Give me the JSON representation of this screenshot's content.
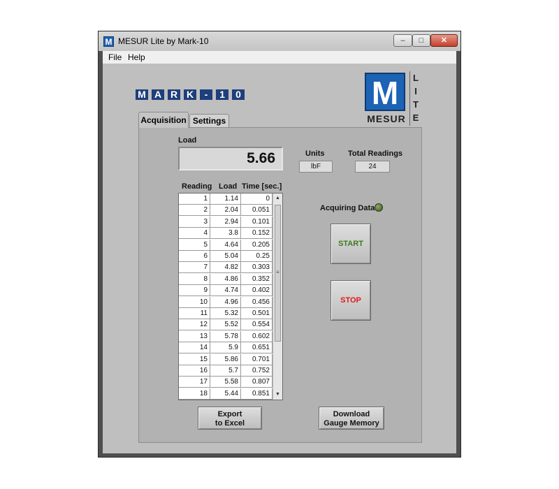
{
  "window": {
    "title": "MESUR Lite by Mark-10",
    "icon_letter": "M"
  },
  "titlebar_buttons": {
    "minimize": "–",
    "maximize": "□",
    "close": "✕"
  },
  "menu": {
    "file": "File",
    "help": "Help"
  },
  "brand": {
    "letters": [
      "M",
      "A",
      "R",
      "K",
      "-",
      "1",
      "0"
    ],
    "mesur_m": "M",
    "mesur_word": "MESUR",
    "lite_letters": [
      "L",
      "I",
      "T",
      "E"
    ]
  },
  "tabs": {
    "acquisition": "Acquisition",
    "settings": "Settings"
  },
  "load": {
    "label": "Load",
    "value": "5.66"
  },
  "units": {
    "label": "Units",
    "value": "lbF"
  },
  "total_readings": {
    "label": "Total Readings",
    "value": "24"
  },
  "table": {
    "headers": [
      "Reading",
      "Load",
      "Time [sec.]"
    ],
    "rows": [
      [
        "1",
        "1.14",
        "0"
      ],
      [
        "2",
        "2.04",
        "0.051"
      ],
      [
        "3",
        "2.94",
        "0.101"
      ],
      [
        "4",
        "3.8",
        "0.152"
      ],
      [
        "5",
        "4.64",
        "0.205"
      ],
      [
        "6",
        "5.04",
        "0.25"
      ],
      [
        "7",
        "4.82",
        "0.303"
      ],
      [
        "8",
        "4.86",
        "0.352"
      ],
      [
        "9",
        "4.74",
        "0.402"
      ],
      [
        "10",
        "4.96",
        "0.456"
      ],
      [
        "11",
        "5.32",
        "0.501"
      ],
      [
        "12",
        "5.52",
        "0.554"
      ],
      [
        "13",
        "5.78",
        "0.602"
      ],
      [
        "14",
        "5.9",
        "0.651"
      ],
      [
        "15",
        "5.86",
        "0.701"
      ],
      [
        "16",
        "5.7",
        "0.752"
      ],
      [
        "17",
        "5.58",
        "0.807"
      ],
      [
        "18",
        "5.44",
        "0.851"
      ]
    ]
  },
  "status": {
    "acquiring_label": "Acquiring Data",
    "led_color": "#4f6a2f"
  },
  "buttons": {
    "start": "START",
    "stop": "STOP",
    "export_line1": "Export",
    "export_line2": "to Excel",
    "download_line1": "Download",
    "download_line2": "Gauge Memory"
  },
  "colors": {
    "brand_blue": "#1e3e7c",
    "mesur_blue": "#1c63b6",
    "start_green": "#3c7a1f",
    "stop_red": "#e01b1b"
  }
}
